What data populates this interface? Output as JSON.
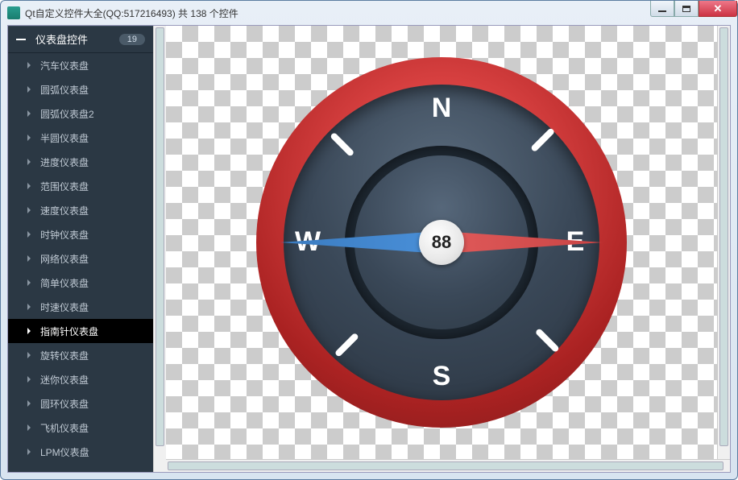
{
  "window": {
    "title": "Qt自定义控件大全(QQ:517216493) 共 138 个控件"
  },
  "sidebar": {
    "category": {
      "title": "仪表盘控件",
      "badge": "19"
    },
    "items": [
      {
        "label": "汽车仪表盘",
        "selected": false
      },
      {
        "label": "圆弧仪表盘",
        "selected": false
      },
      {
        "label": "圆弧仪表盘2",
        "selected": false
      },
      {
        "label": "半圆仪表盘",
        "selected": false
      },
      {
        "label": "进度仪表盘",
        "selected": false
      },
      {
        "label": "范围仪表盘",
        "selected": false
      },
      {
        "label": "速度仪表盘",
        "selected": false
      },
      {
        "label": "时钟仪表盘",
        "selected": false
      },
      {
        "label": "网络仪表盘",
        "selected": false
      },
      {
        "label": "简单仪表盘",
        "selected": false
      },
      {
        "label": "时速仪表盘",
        "selected": false
      },
      {
        "label": "指南针仪表盘",
        "selected": true
      },
      {
        "label": "旋转仪表盘",
        "selected": false
      },
      {
        "label": "迷你仪表盘",
        "selected": false
      },
      {
        "label": "圆环仪表盘",
        "selected": false
      },
      {
        "label": "飞机仪表盘",
        "selected": false
      },
      {
        "label": "LPM仪表盘",
        "selected": false
      }
    ]
  },
  "compass": {
    "value": "88",
    "labels": {
      "n": "N",
      "s": "S",
      "e": "E",
      "w": "W"
    },
    "heading_deg": 90,
    "colors": {
      "ring_outer": "#c03030",
      "ring_face": "#3a4858",
      "needle_east": "#d94c4c",
      "needle_west": "#4a90d9",
      "hub": "#eeeeee"
    }
  }
}
